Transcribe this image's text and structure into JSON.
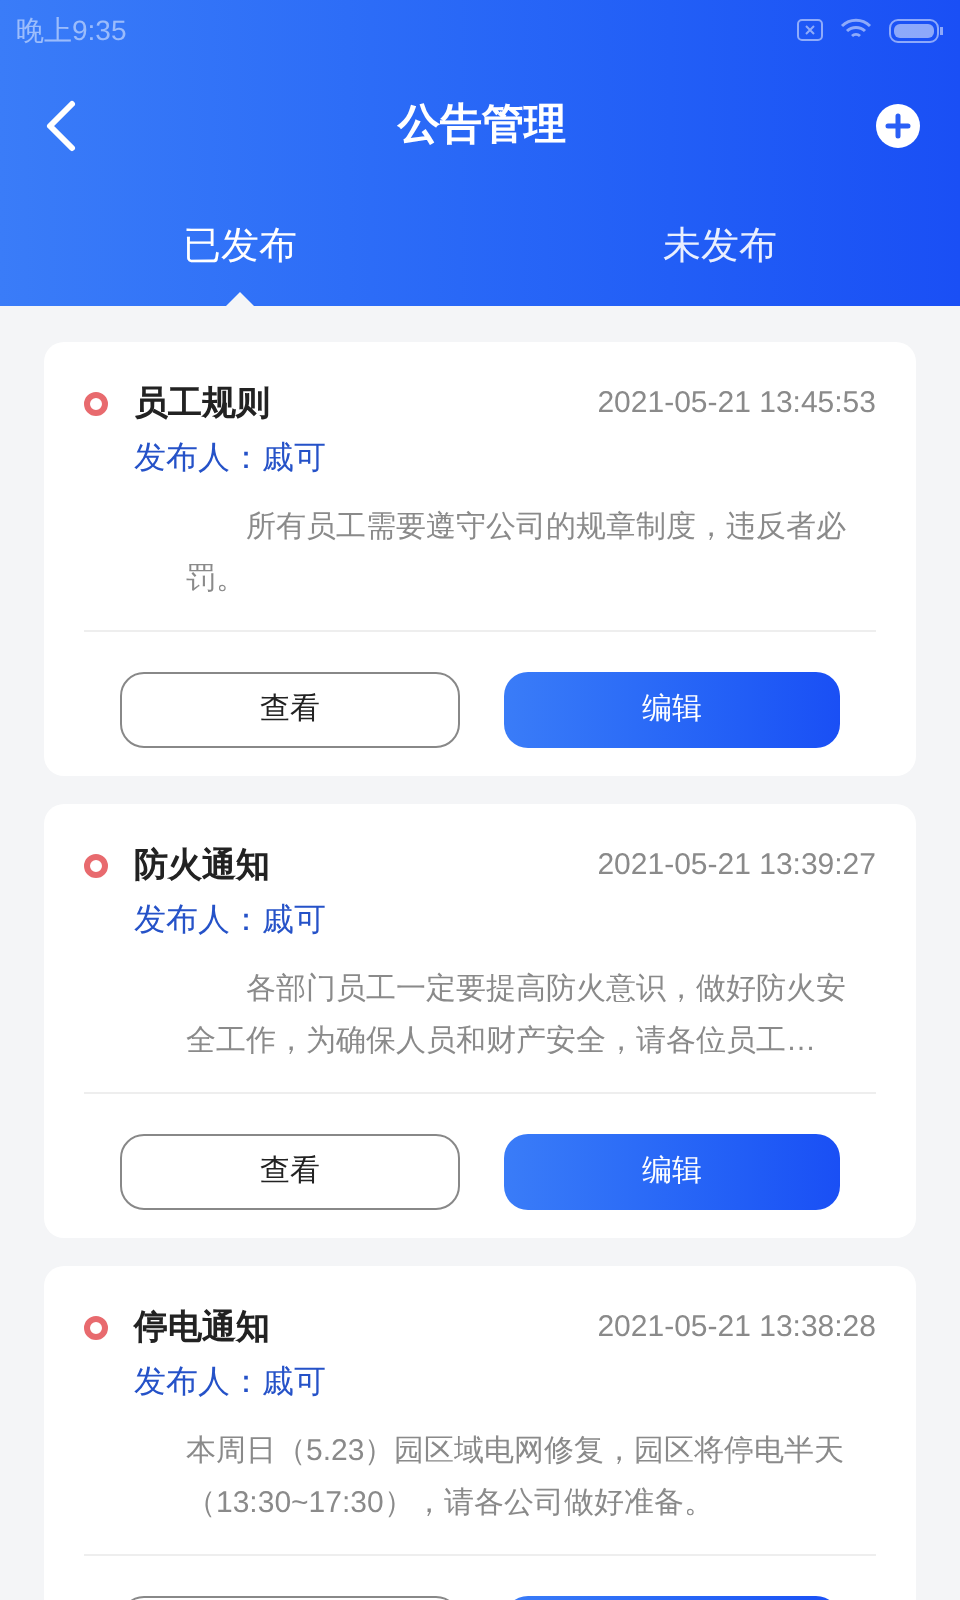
{
  "status_bar": {
    "time": "晚上9:35"
  },
  "header": {
    "title": "公告管理"
  },
  "tabs": [
    {
      "label": "已发布",
      "selected": true
    },
    {
      "label": "未发布",
      "selected": false
    }
  ],
  "notices": [
    {
      "title": "员工规则",
      "time": "2021-05-21 13:45:53",
      "publisher": "发布人：戚可",
      "body": "　　所有员工需要遵守公司的规章制度，违反者必罚。",
      "buttons": [
        {
          "kind": "view",
          "label": "查看"
        },
        {
          "kind": "edit",
          "label": "编辑"
        }
      ]
    },
    {
      "title": "防火通知",
      "time": "2021-05-21 13:39:27",
      "publisher": "发布人：戚可",
      "body": "　　各部门员工一定要提高防火意识，做好防火安全工作，为确保人员和财产安全，请各位员工…",
      "buttons": [
        {
          "kind": "view",
          "label": "查看"
        },
        {
          "kind": "edit",
          "label": "编辑"
        }
      ]
    },
    {
      "title": "停电通知",
      "time": "2021-05-21 13:38:28",
      "publisher": "发布人：戚可",
      "body": "本周日（5.23）园区域电网修复，园区将停电半天（13:30~17:30），请各公司做好准备。",
      "buttons": [
        {
          "kind": "view"
        },
        {
          "kind": "edit"
        }
      ]
    }
  ]
}
